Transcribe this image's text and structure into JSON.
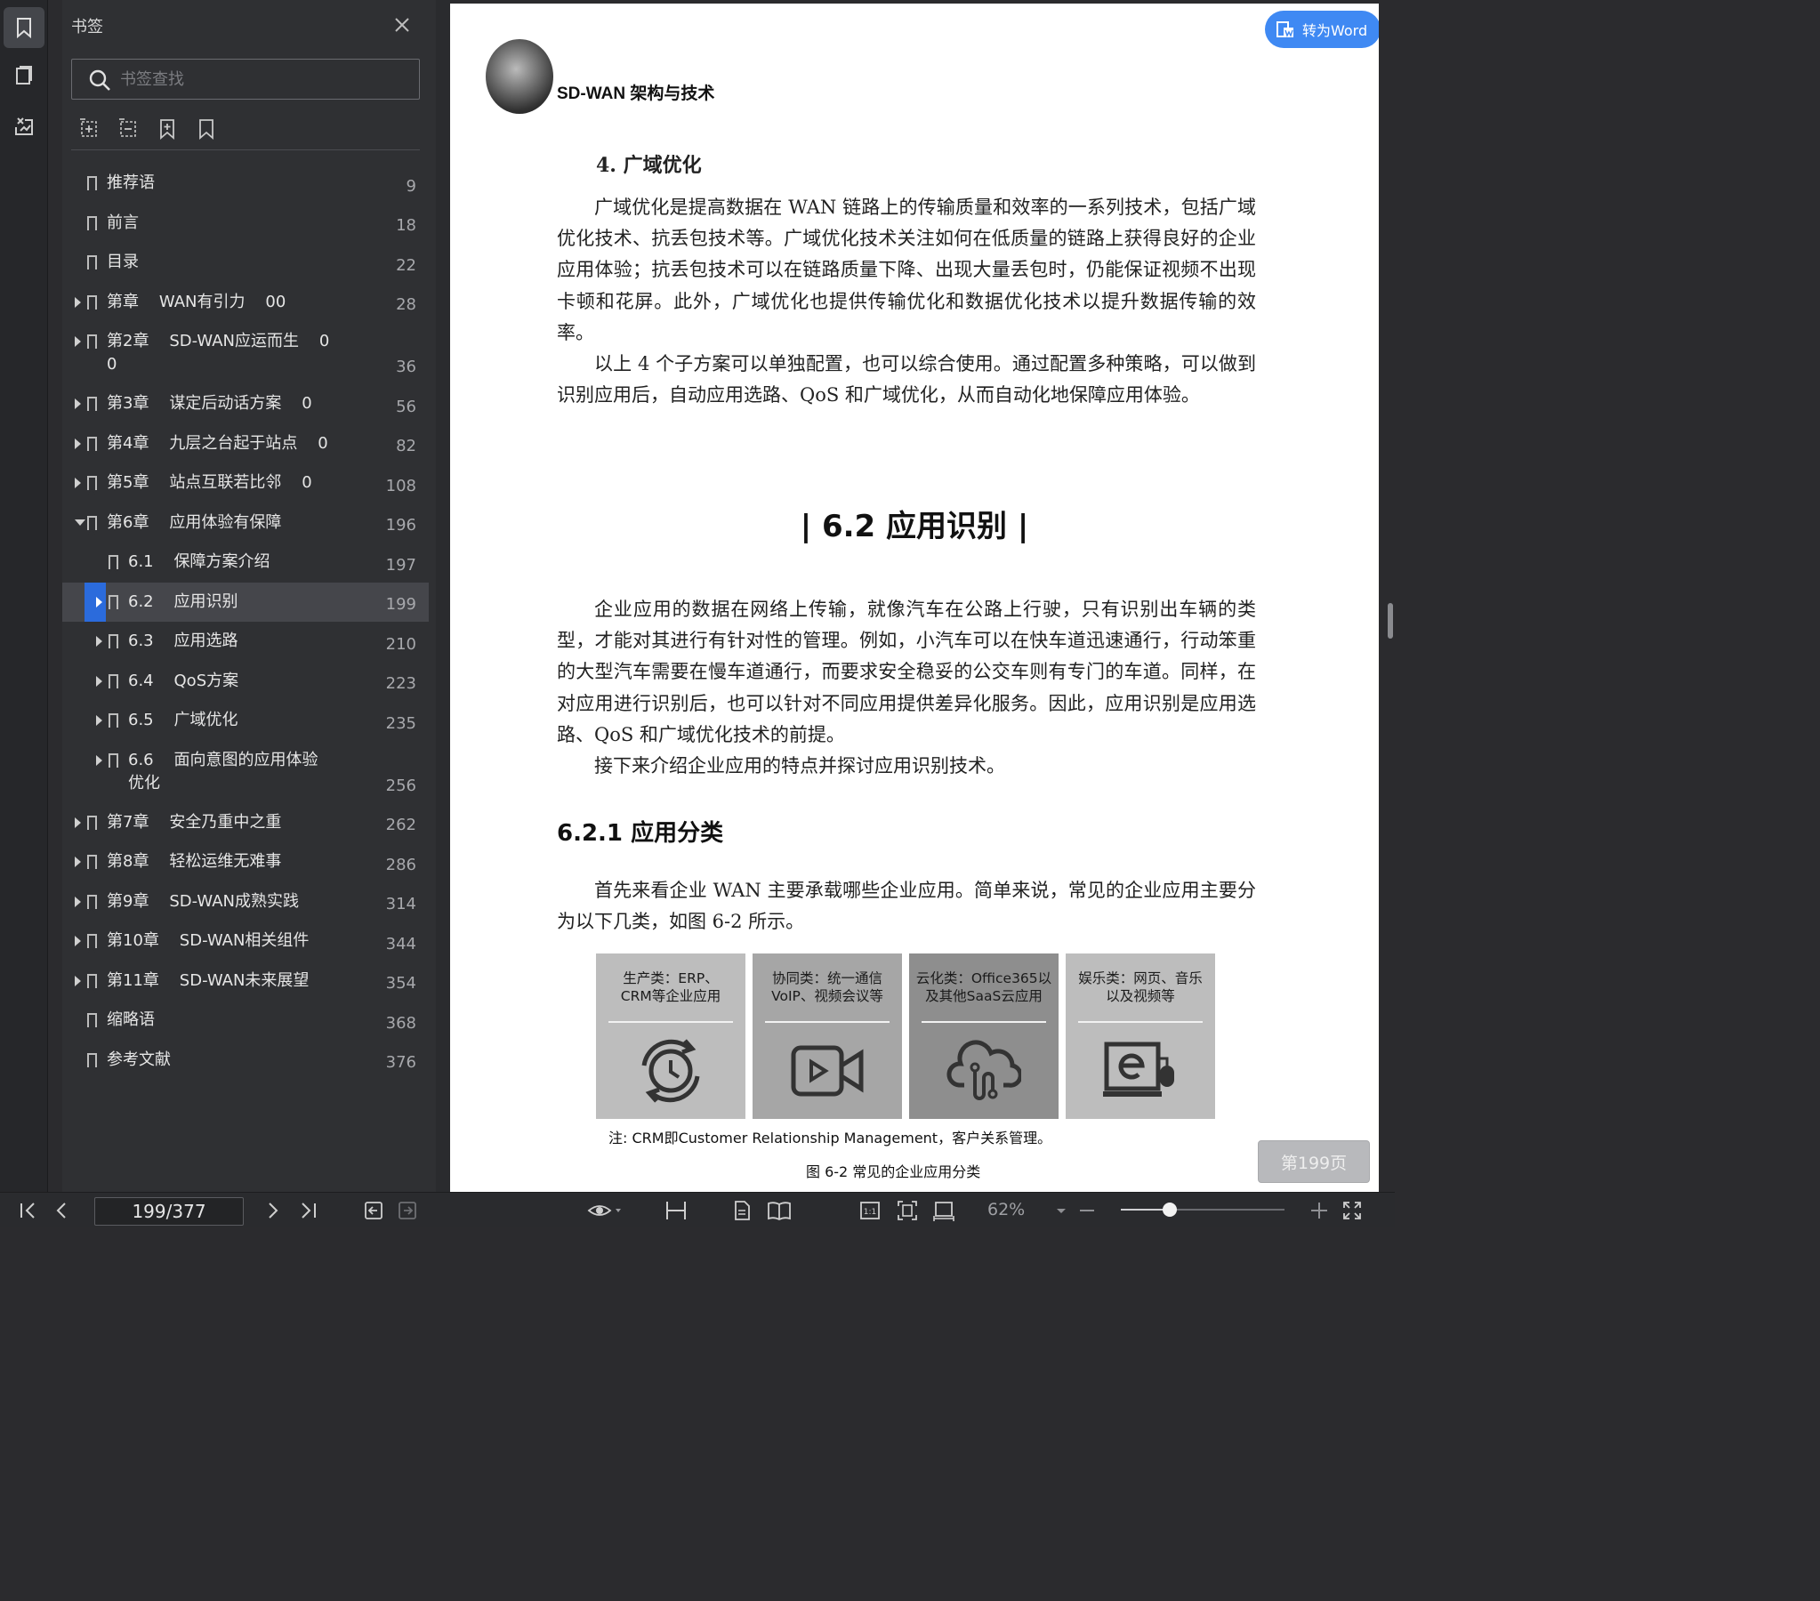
{
  "panel": {
    "title": "书签",
    "search_placeholder": "书签查找"
  },
  "bookmarks": [
    {
      "label": "推荐语",
      "page": "9",
      "level": 0,
      "expander": "none"
    },
    {
      "label": "前言",
      "page": "18",
      "level": 0,
      "expander": "none"
    },
    {
      "label": "目录",
      "page": "22",
      "level": 0,
      "expander": "none"
    },
    {
      "label": "第章    WAN有引力    00",
      "page": "28",
      "level": 0,
      "expander": "closed"
    },
    {
      "label": "第2章    SD-WAN应运而生    0\n0",
      "page": "36",
      "level": 0,
      "expander": "closed"
    },
    {
      "label": "第3章    谋定后动话方案    0",
      "page": "56",
      "level": 0,
      "expander": "closed"
    },
    {
      "label": "第4章    九层之台起于站点    0",
      "page": "82",
      "level": 0,
      "expander": "closed"
    },
    {
      "label": "第5章    站点互联若比邻    0",
      "page": "108",
      "level": 0,
      "expander": "closed"
    },
    {
      "label": "第6章    应用体验有保障",
      "page": "196",
      "level": 0,
      "expander": "open"
    },
    {
      "label": "6.1    保障方案介绍",
      "page": "197",
      "level": 1,
      "expander": "none"
    },
    {
      "label": "6.2    应用识别",
      "page": "199",
      "level": 1,
      "expander": "closed",
      "selected": true
    },
    {
      "label": "6.3    应用选路",
      "page": "210",
      "level": 1,
      "expander": "closed"
    },
    {
      "label": "6.4    QoS方案",
      "page": "223",
      "level": 1,
      "expander": "closed"
    },
    {
      "label": "6.5    广域优化",
      "page": "235",
      "level": 1,
      "expander": "closed"
    },
    {
      "label": "6.6    面向意图的应用体验\n优化",
      "page": "256",
      "level": 1,
      "expander": "closed"
    },
    {
      "label": "第7章    安全乃重中之重",
      "page": "262",
      "level": 0,
      "expander": "closed"
    },
    {
      "label": "第8章    轻松运维无难事",
      "page": "286",
      "level": 0,
      "expander": "closed"
    },
    {
      "label": "第9章    SD-WAN成熟实践",
      "page": "314",
      "level": 0,
      "expander": "closed"
    },
    {
      "label": "第10章    SD-WAN相关组件",
      "page": "344",
      "level": 0,
      "expander": "closed"
    },
    {
      "label": "第11章    SD-WAN未来展望",
      "page": "354",
      "level": 0,
      "expander": "closed"
    },
    {
      "label": "缩略语",
      "page": "368",
      "level": 0,
      "expander": "none"
    },
    {
      "label": "参考文献",
      "page": "376",
      "level": 0,
      "expander": "none"
    }
  ],
  "document": {
    "book_title": "SD-WAN 架构与技术",
    "heading4": "4.  广域优化",
    "para1": "广域优化是提高数据在 WAN 链路上的传输质量和效率的一系列技术，包括广域优化技术、抗丢包技术等。广域优化技术关注如何在低质量的链路上获得良好的企业应用体验；抗丢包技术可以在链路质量下降、出现大量丢包时，仍能保证视频不出现卡顿和花屏。此外，广域优化也提供传输优化和数据优化技术以提升数据传输的效率。",
    "para2": "以上 4 个子方案可以单独配置，也可以综合使用。通过配置多种策略，可以做到识别应用后，自动应用选路、QoS 和广域优化，从而自动化地保障应用体验。",
    "section": "| 6.2    应用识别 |",
    "para3": "企业应用的数据在网络上传输，就像汽车在公路上行驶，只有识别出车辆的类型，才能对其进行有针对性的管理。例如，小汽车可以在快车道迅速通行，行动笨重的大型汽车需要在慢车道通行，而要求安全稳妥的公交车则有专门的车道。同样，在对应用进行识别后，也可以针对不同应用提供差异化服务。因此，应用识别是应用选路、QoS 和广域优化技术的前提。",
    "para4": "接下来介绍企业应用的特点并探讨应用识别技术。",
    "subsection": "6.2.1    应用分类",
    "para5": "首先来看企业 WAN 主要承载哪些企业应用。简单来说，常见的企业应用主要分为以下几类，如图 6-2 所示。",
    "figure_categories": [
      {
        "text": "生产类：ERP、\nCRM等企业应用",
        "icon": "sync-clock-icon",
        "bg": "#bdbdbd"
      },
      {
        "text": "协同类：统一通信\nVoIP、视频会议等",
        "icon": "video-icon",
        "bg": "#a6a6a6"
      },
      {
        "text": "云化类：Office365以\n及其他SaaS云应用",
        "icon": "cloud-icon",
        "bg": "#8e8e8e"
      },
      {
        "text": "娱乐类：网页、音乐\n以及视频等",
        "icon": "browser-ie-icon",
        "bg": "#bdbdbd"
      }
    ],
    "figure_note": "注: CRM即Customer Relationship Management，客户关系管理。",
    "figure_caption": "图 6-2    常见的企业应用分类"
  },
  "overlay": {
    "to_word": "转为Word",
    "page_badge": "第199页"
  },
  "toolbar": {
    "page_input": "199/377",
    "zoom": "62%",
    "zoom_fraction": 0.3
  }
}
